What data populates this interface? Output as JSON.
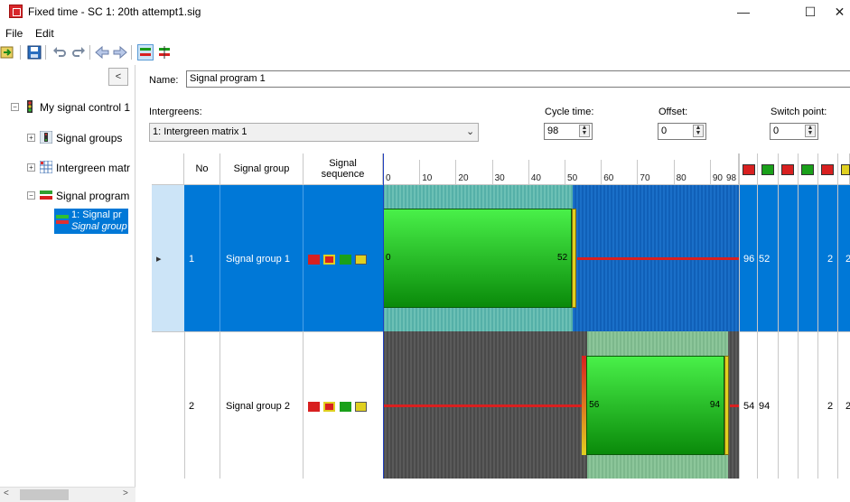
{
  "window": {
    "title": "Fixed time - SC 1: 20th attempt1.sig",
    "minimize_label": "—",
    "maximize_label": "☐",
    "close_label": "✕"
  },
  "menu": {
    "file": "File",
    "edit": "Edit"
  },
  "toolbar": {
    "icons": [
      "import-icon",
      "save-icon",
      "undo-icon",
      "redo-icon",
      "back-icon",
      "forward-icon",
      "signal-view-icon",
      "signal-view-alt-icon"
    ]
  },
  "tree": {
    "collapse_label": "<",
    "root": "My signal control 1",
    "items": [
      {
        "label": "Signal groups",
        "expander": "+"
      },
      {
        "label": "Intergreen matr",
        "expander": "+"
      },
      {
        "label": "Signal program",
        "expander": "−"
      }
    ],
    "selected_line1": "1: Signal pr",
    "selected_line2": "Signal group",
    "scroll_left": "<",
    "scroll_right": ">"
  },
  "form": {
    "name_label": "Name:",
    "name_value": "Signal program 1",
    "intergreens_label": "Intergreens:",
    "intergreens_value": "1: Intergreen matrix 1",
    "cycle_label": "Cycle time:",
    "cycle_value": "98",
    "offset_label": "Offset:",
    "offset_value": "0",
    "switch_label": "Switch point:",
    "switch_value": "0"
  },
  "grid": {
    "headers": {
      "no": "No",
      "group": "Signal group",
      "sequence_line1": "Signal",
      "sequence_line2": "sequence"
    },
    "ticks": [
      "0",
      "10",
      "20",
      "30",
      "40",
      "50",
      "60",
      "70",
      "80",
      "90",
      "98"
    ],
    "tick_values": [
      0,
      10,
      20,
      30,
      40,
      50,
      60,
      70,
      80,
      90,
      98
    ],
    "cycle": 98,
    "rows": [
      {
        "marker": "▸",
        "no": "1",
        "group": "Signal group 1",
        "green_start": 0,
        "green_end": 52,
        "start_label": "0",
        "end_label": "52",
        "extra1": "96",
        "extra2": "52",
        "extra3": "2",
        "extra4": "2"
      },
      {
        "marker": "",
        "no": "2",
        "group": "Signal group 2",
        "green_start": 56,
        "green_end": 94,
        "start_label": "56",
        "end_label": "94",
        "extra1": "54",
        "extra2": "94",
        "extra3": "2",
        "extra4": "2"
      }
    ]
  },
  "colors": {
    "selection": "#0078d7",
    "green_top": "#49f049",
    "green_bottom": "#0a8a0a",
    "red_line": "#d82020",
    "amber": "#e0d020",
    "teal": "#5fb9a0"
  }
}
